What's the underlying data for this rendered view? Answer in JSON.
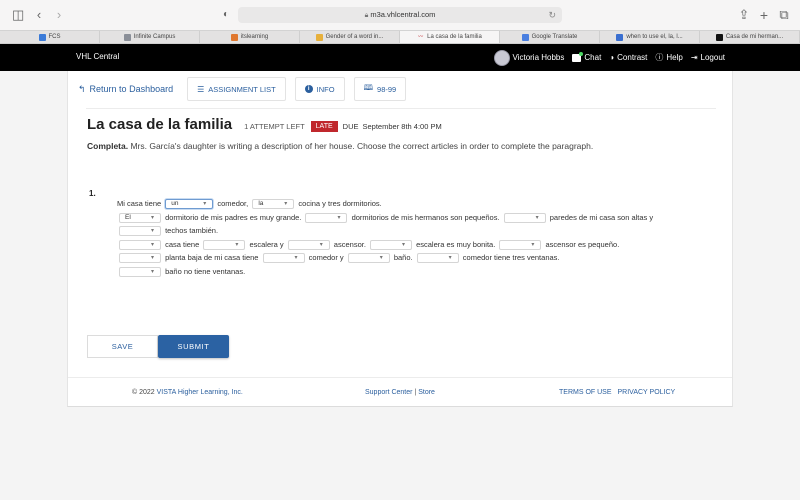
{
  "browser": {
    "url": "m3a.vhlcentral.com",
    "tabs": [
      {
        "label": "FCS",
        "icon": "cloud-icon",
        "color": "#3b7bd8",
        "active": false
      },
      {
        "label": "Infinite Campus",
        "icon": "infinite-campus-icon",
        "color": "#8a8f98",
        "active": false
      },
      {
        "label": "itslearning",
        "icon": "itslearning-icon",
        "color": "#e0782f",
        "active": false
      },
      {
        "label": "Gender of a word in...",
        "icon": "gender-site-icon",
        "color": "#e7b03b",
        "active": false
      },
      {
        "label": "La casa de la familia",
        "icon": "vhl-icon",
        "color": "#c0282d",
        "active": true
      },
      {
        "label": "Google Translate",
        "icon": "google-translate-icon",
        "color": "#4a7fe0",
        "active": false
      },
      {
        "label": "when to use el, la, l...",
        "icon": "site-icon",
        "color": "#3a6fd0",
        "active": false
      },
      {
        "label": "Casa de mi herman...",
        "icon": "site-icon",
        "color": "#111111",
        "active": false
      }
    ]
  },
  "header": {
    "brand": "VHL Central",
    "user_name": "Victoria Hobbs",
    "chat": "Chat",
    "contrast": "Contrast",
    "help": "Help",
    "logout": "Logout"
  },
  "nav": {
    "back": "Return to Dashboard",
    "assignment_list": "ASSIGNMENT LIST",
    "info": "INFO",
    "pages": "98-99"
  },
  "assignment": {
    "title": "La casa de la familia",
    "attempts": "1 ATTEMPT LEFT",
    "late_badge": "LATE",
    "due_label": "DUE",
    "due_date": "September 8th 4:00 PM",
    "instruction_bold": "Completa.",
    "instruction_text": " Mrs. García's daughter is writing a description of her house. Choose the correct articles in order to complete the paragraph."
  },
  "question": {
    "number": "1.",
    "segments": [
      {
        "text": "Mi casa tiene "
      },
      {
        "select": "un",
        "focused": true
      },
      {
        "text": " comedor, "
      },
      {
        "select": "la"
      },
      {
        "text": " cocina y tres dormitorios."
      },
      {
        "break": true
      },
      {
        "select": "El"
      },
      {
        "text": " dormitorio de mis padres es muy grande. "
      },
      {
        "select": ""
      },
      {
        "text": " dormitorios de mis hermanos son pequeños. "
      },
      {
        "select": ""
      },
      {
        "text": " paredes de mi casa son altas y "
      },
      {
        "select": ""
      },
      {
        "text": " techos también."
      },
      {
        "break": true
      },
      {
        "select": ""
      },
      {
        "text": " casa tiene "
      },
      {
        "select": ""
      },
      {
        "text": " escalera y "
      },
      {
        "select": ""
      },
      {
        "text": " ascensor. "
      },
      {
        "select": ""
      },
      {
        "text": " escalera es muy bonita. "
      },
      {
        "select": ""
      },
      {
        "text": " ascensor es pequeño."
      },
      {
        "break": true
      },
      {
        "select": ""
      },
      {
        "text": " planta baja de mi casa tiene "
      },
      {
        "select": ""
      },
      {
        "text": " comedor y "
      },
      {
        "select": ""
      },
      {
        "text": " baño. "
      },
      {
        "select": ""
      },
      {
        "text": " comedor tiene tres ventanas."
      },
      {
        "break": true
      },
      {
        "select": ""
      },
      {
        "text": " baño no tiene ventanas."
      }
    ]
  },
  "actions": {
    "save": "SAVE",
    "submit": "SUBMIT"
  },
  "footer": {
    "copyright_prefix": "© 2022 ",
    "copyright_link": "VISTA Higher Learning, Inc.",
    "support": "Support Center",
    "divider": " | ",
    "store": "Store",
    "terms": "TERMS OF USE",
    "privacy": "PRIVACY POLICY"
  },
  "colors": {
    "accent": "#2b62a3",
    "link": "#2b5f9e",
    "late": "#c0282d",
    "header_bg": "#000000"
  }
}
